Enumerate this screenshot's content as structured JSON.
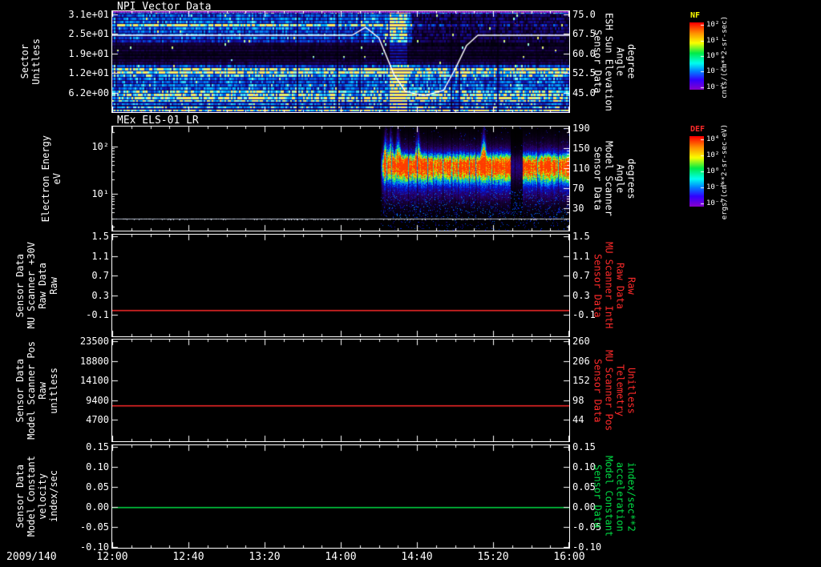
{
  "panels": [
    {
      "id": "npi",
      "title": "NPI Vector Data",
      "left_title_lines": [
        "Sector",
        "Unitless"
      ],
      "left_ticks": [
        "3.1e+01",
        "2.5e+01",
        "1.9e+01",
        "1.2e+01",
        "6.2e+00"
      ],
      "right_title_lines": [
        "Sensor Data",
        "ESH Sun Elevation",
        "Angle",
        "degree"
      ],
      "right_ticks": [
        "75.0",
        "67.5",
        "60.0",
        "52.5",
        "45.0"
      ],
      "right_color": "#ffffff"
    },
    {
      "id": "els",
      "title": "MEx ELS-01 LR",
      "left_title_lines": [
        "Electron Energy",
        "eV"
      ],
      "left_ticks": [
        "10²",
        "10¹"
      ],
      "right_title_lines": [
        "Sensor Data",
        "Model Scanner",
        "Angle",
        "degrees"
      ],
      "right_ticks": [
        "190",
        "150",
        "110",
        "70",
        "30"
      ],
      "right_color": "#ffffff"
    },
    {
      "id": "mu_inth",
      "title": "",
      "left_title_lines": [
        "Sensor Data",
        "MU Scanner +30V",
        "Raw Data",
        "Raw"
      ],
      "left_ticks": [
        "1.5",
        "1.1",
        "0.7",
        "0.3",
        "-0.1"
      ],
      "right_title_lines": [
        "Sensor Data",
        "MU Scanner IntH",
        "Raw Data",
        "Raw"
      ],
      "right_ticks": [
        "1.5",
        "1.1",
        "0.7",
        "0.3",
        "-0.1"
      ],
      "right_color": "#ff2a2a"
    },
    {
      "id": "scanner_pos",
      "title": "",
      "left_title_lines": [
        "Sensor Data",
        "Model Scanner Pos",
        "Raw",
        "unitless"
      ],
      "left_ticks": [
        "23500",
        "18800",
        "14100",
        "9400",
        "4700"
      ],
      "right_title_lines": [
        "Sensor Data",
        "MU Scanner Pos",
        "Telemetry",
        "Unitless"
      ],
      "right_ticks": [
        "260",
        "206",
        "152",
        "98",
        "44"
      ],
      "right_color": "#ff2a2a"
    },
    {
      "id": "model_const",
      "title": "",
      "left_title_lines": [
        "Sensor Data",
        "Model Constant",
        "velocity",
        "index/sec"
      ],
      "left_ticks": [
        "0.15",
        "0.10",
        "0.05",
        "0.00",
        "-0.05",
        "-0.10"
      ],
      "right_title_lines": [
        "Sensor Data",
        "Model Constant",
        "acceleration",
        "index/sec**2"
      ],
      "right_ticks": [
        "0.15",
        "0.10",
        "0.05",
        "0.00",
        "-0.05",
        "-0.10"
      ],
      "right_color": "#00dd44"
    }
  ],
  "time_axis": {
    "date": "2009/140",
    "ticks": [
      "12:00",
      "12:40",
      "13:20",
      "14:00",
      "14:40",
      "15:20",
      "16:00"
    ]
  },
  "colorbars": [
    {
      "name": "NF",
      "name_color": "#ffff00",
      "ticks": [
        "10²",
        "10¹",
        "10⁰",
        "10⁻¹",
        "10⁻²"
      ],
      "unit": "cnts/(cm**2-sr-sec)"
    },
    {
      "name": "DEF",
      "name_color": "#ff2a2a",
      "ticks": [
        "10⁴",
        "10²",
        "10⁰",
        "10⁻²",
        "10⁻⁴"
      ],
      "unit": "ergs/(cm**2-sr-sec-eV)"
    }
  ],
  "chart_data": [
    {
      "id": "npi_spectrogram",
      "type": "heatmap",
      "title": "NPI Vector Data",
      "x_date": "2009/140",
      "x_range": [
        "12:00",
        "16:00"
      ],
      "ylabel": "Sector Unitless",
      "y_ticks": [
        31,
        25,
        19,
        12,
        6.2
      ],
      "z_colorbar": "NF",
      "z_unit": "cnts/(cm**2-sr-sec)",
      "row_intensity": [
        0.55,
        0.45,
        0.5,
        0.48,
        0.9,
        0.5,
        0.42,
        0.48,
        0.45,
        0.35,
        0.1,
        0.07,
        0.1,
        0.05,
        0.07,
        0.1,
        0.12,
        0.4,
        0.85,
        0.92,
        0.7,
        0.5,
        0.45,
        0.5,
        0.52,
        0.72,
        0.8,
        0.85,
        0.75,
        0.55,
        0.65,
        0.9
      ],
      "bright_column_time": "14:30",
      "dim_after_time": "14:37",
      "overlay": {
        "name": "ESH Sun Elevation Angle",
        "unit": "degree",
        "color": "#ffffff",
        "axis_ticks": [
          75.0,
          67.5,
          60.0,
          52.5,
          45.0
        ],
        "points": [
          [
            "12:00",
            67
          ],
          [
            "14:06",
            67
          ],
          [
            "14:13",
            70
          ],
          [
            "14:20",
            66
          ],
          [
            "14:28",
            52
          ],
          [
            "14:34",
            45.5
          ],
          [
            "14:44",
            44
          ],
          [
            "14:54",
            46
          ],
          [
            "15:00",
            54
          ],
          [
            "15:06",
            63
          ],
          [
            "15:12",
            67
          ],
          [
            "16:00",
            67
          ]
        ]
      }
    },
    {
      "id": "els_spectrogram",
      "type": "heatmap",
      "title": "MEx ELS-01 LR",
      "x_range": [
        "12:00",
        "16:00"
      ],
      "ylabel": "Electron Energy eV",
      "y_scale": "log",
      "y_tick_labels": [
        "10²",
        "10¹"
      ],
      "right_ticks": [
        190,
        150,
        110,
        70,
        30
      ],
      "z_colorbar": "DEF",
      "z_unit": "ergs/(cm**2-sr-sec-eV)",
      "signal": {
        "start": "14:21",
        "end": "16:00",
        "gap": "15:32",
        "core_center_frac": 0.37,
        "baseline_frac": 0.885
      }
    },
    {
      "id": "mu_scanner_inth",
      "type": "line",
      "x_range": [
        "12:00",
        "16:00"
      ],
      "y_ticks": [
        1.5,
        1.1,
        0.7,
        0.3,
        -0.1
      ],
      "series": [
        {
          "name": "MU Scanner IntH Raw Data Raw",
          "color": "#ff2a2a",
          "shape": "constant",
          "value": 0.0
        }
      ]
    },
    {
      "id": "scanner_pos",
      "type": "line",
      "x_range": [
        "12:00",
        "16:00"
      ],
      "left_y_ticks": [
        23500,
        18800,
        14100,
        9400,
        4700
      ],
      "right_y_ticks": [
        260,
        206,
        152,
        98,
        44
      ],
      "series": [
        {
          "name": "MU Scanner Pos Telemetry",
          "color": "#ff2a2a",
          "shape": "constant",
          "value": 83,
          "axis": "right"
        }
      ]
    },
    {
      "id": "model_constant",
      "type": "line",
      "x_range": [
        "12:00",
        "16:00"
      ],
      "y_ticks": [
        0.15,
        0.1,
        0.05,
        0.0,
        -0.05,
        -0.1
      ],
      "series": [
        {
          "name": "Model Constant acceleration index/sec**2",
          "color": "#00dd44",
          "shape": "constant",
          "value": 0.0
        }
      ]
    }
  ]
}
